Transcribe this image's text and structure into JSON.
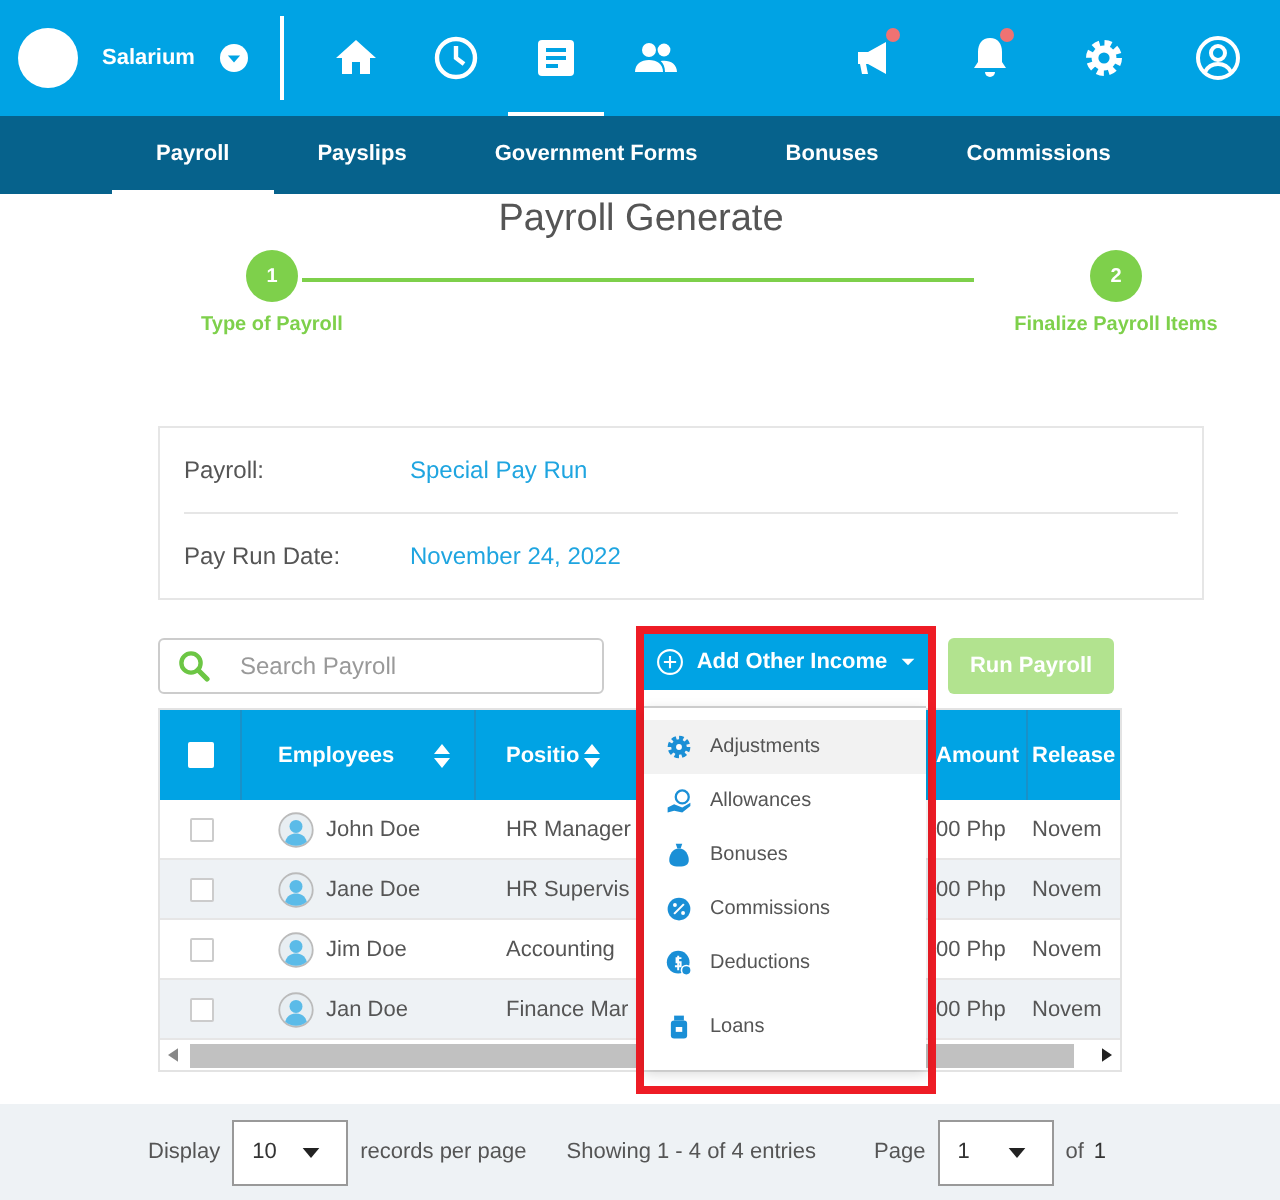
{
  "brand": {
    "name": "Salarium"
  },
  "main_nav": [
    {
      "selected": false,
      "notification": false
    },
    {
      "selected": false,
      "notification": false
    },
    {
      "selected": true,
      "notification": false
    },
    {
      "selected": false,
      "notification": false
    }
  ],
  "right_nav": [
    {
      "notification": true
    },
    {
      "notification": true
    },
    {
      "notification": false
    },
    {
      "notification": false
    }
  ],
  "tabs": [
    {
      "label": "Payroll",
      "selected": true
    },
    {
      "label": "Payslips",
      "selected": false
    },
    {
      "label": "Government Forms",
      "selected": false
    },
    {
      "label": "Bonuses",
      "selected": false
    },
    {
      "label": "Commissions",
      "selected": false
    }
  ],
  "page_title": "Payroll Generate",
  "steps": [
    {
      "number": "1",
      "label": "Type of Payroll",
      "completed": true
    },
    {
      "number": "2",
      "label": "Finalize Payroll Items",
      "completed": true
    }
  ],
  "details": [
    {
      "label": "Payroll:",
      "value": "Special Pay Run"
    },
    {
      "label": "Pay Run Date:",
      "value": "November 24, 2022"
    }
  ],
  "search": {
    "placeholder": "Search Payroll"
  },
  "add_income_button": "Add Other Income",
  "run_button": {
    "label": "Run Payroll",
    "disabled": true
  },
  "table": {
    "select_all_checked": false,
    "columns": [
      "Employees",
      "Positio",
      "Amount",
      "Release"
    ],
    "rows": [
      {
        "checked": false,
        "employee": "John Doe",
        "position": "HR Manager",
        "amount": "00 Php",
        "release": "Novem"
      },
      {
        "checked": false,
        "employee": "Jane Doe",
        "position": "HR Supervis",
        "amount": "00 Php",
        "release": "Novem"
      },
      {
        "checked": false,
        "employee": "Jim Doe",
        "position": "Accounting",
        "amount": "00 Php",
        "release": "Novem"
      },
      {
        "checked": false,
        "employee": "Jan Doe",
        "position": "Finance Mar",
        "amount": "00 Php",
        "release": "Novem"
      }
    ]
  },
  "income_menu": [
    {
      "label": "Adjustments",
      "highlighted": true
    },
    {
      "label": "Allowances",
      "highlighted": false
    },
    {
      "label": "Bonuses",
      "highlighted": false
    },
    {
      "label": "Commissions",
      "highlighted": false
    },
    {
      "label": "Deductions",
      "highlighted": false
    },
    {
      "label": "Loans",
      "highlighted": false
    }
  ],
  "pagination": {
    "display_label": "Display",
    "per_page": "10",
    "records_label": "records per page",
    "showing": "Showing 1 - 4 of 4 entries",
    "page_label": "Page",
    "page": "1",
    "of_label": "of",
    "total_pages": "1"
  }
}
